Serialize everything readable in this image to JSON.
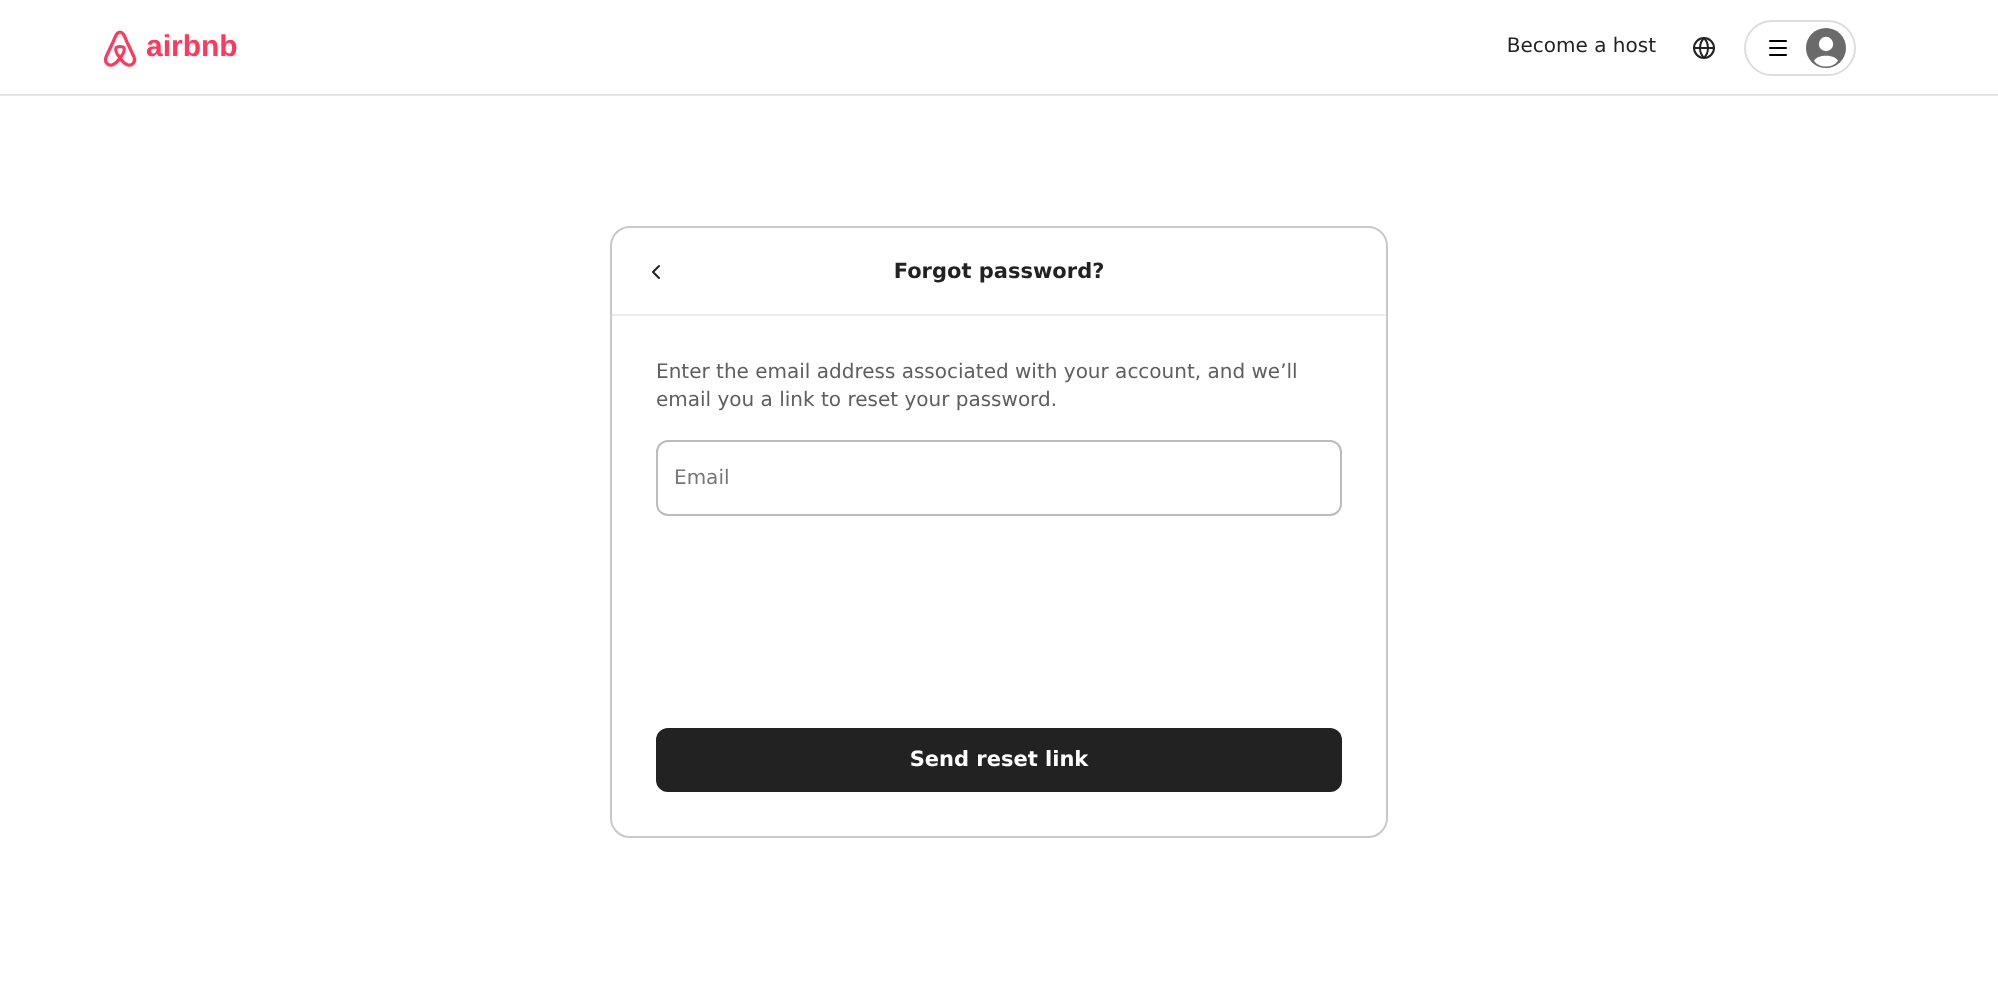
{
  "header": {
    "logo": "airbnb",
    "host_link": "Become a host"
  },
  "dialog": {
    "title": "Forgot password?",
    "description": "Enter the email address associated with your account, and we’ll email you a link to reset your password.",
    "email": {
      "placeholder": "Email"
    },
    "submit": "Send reset link"
  }
}
